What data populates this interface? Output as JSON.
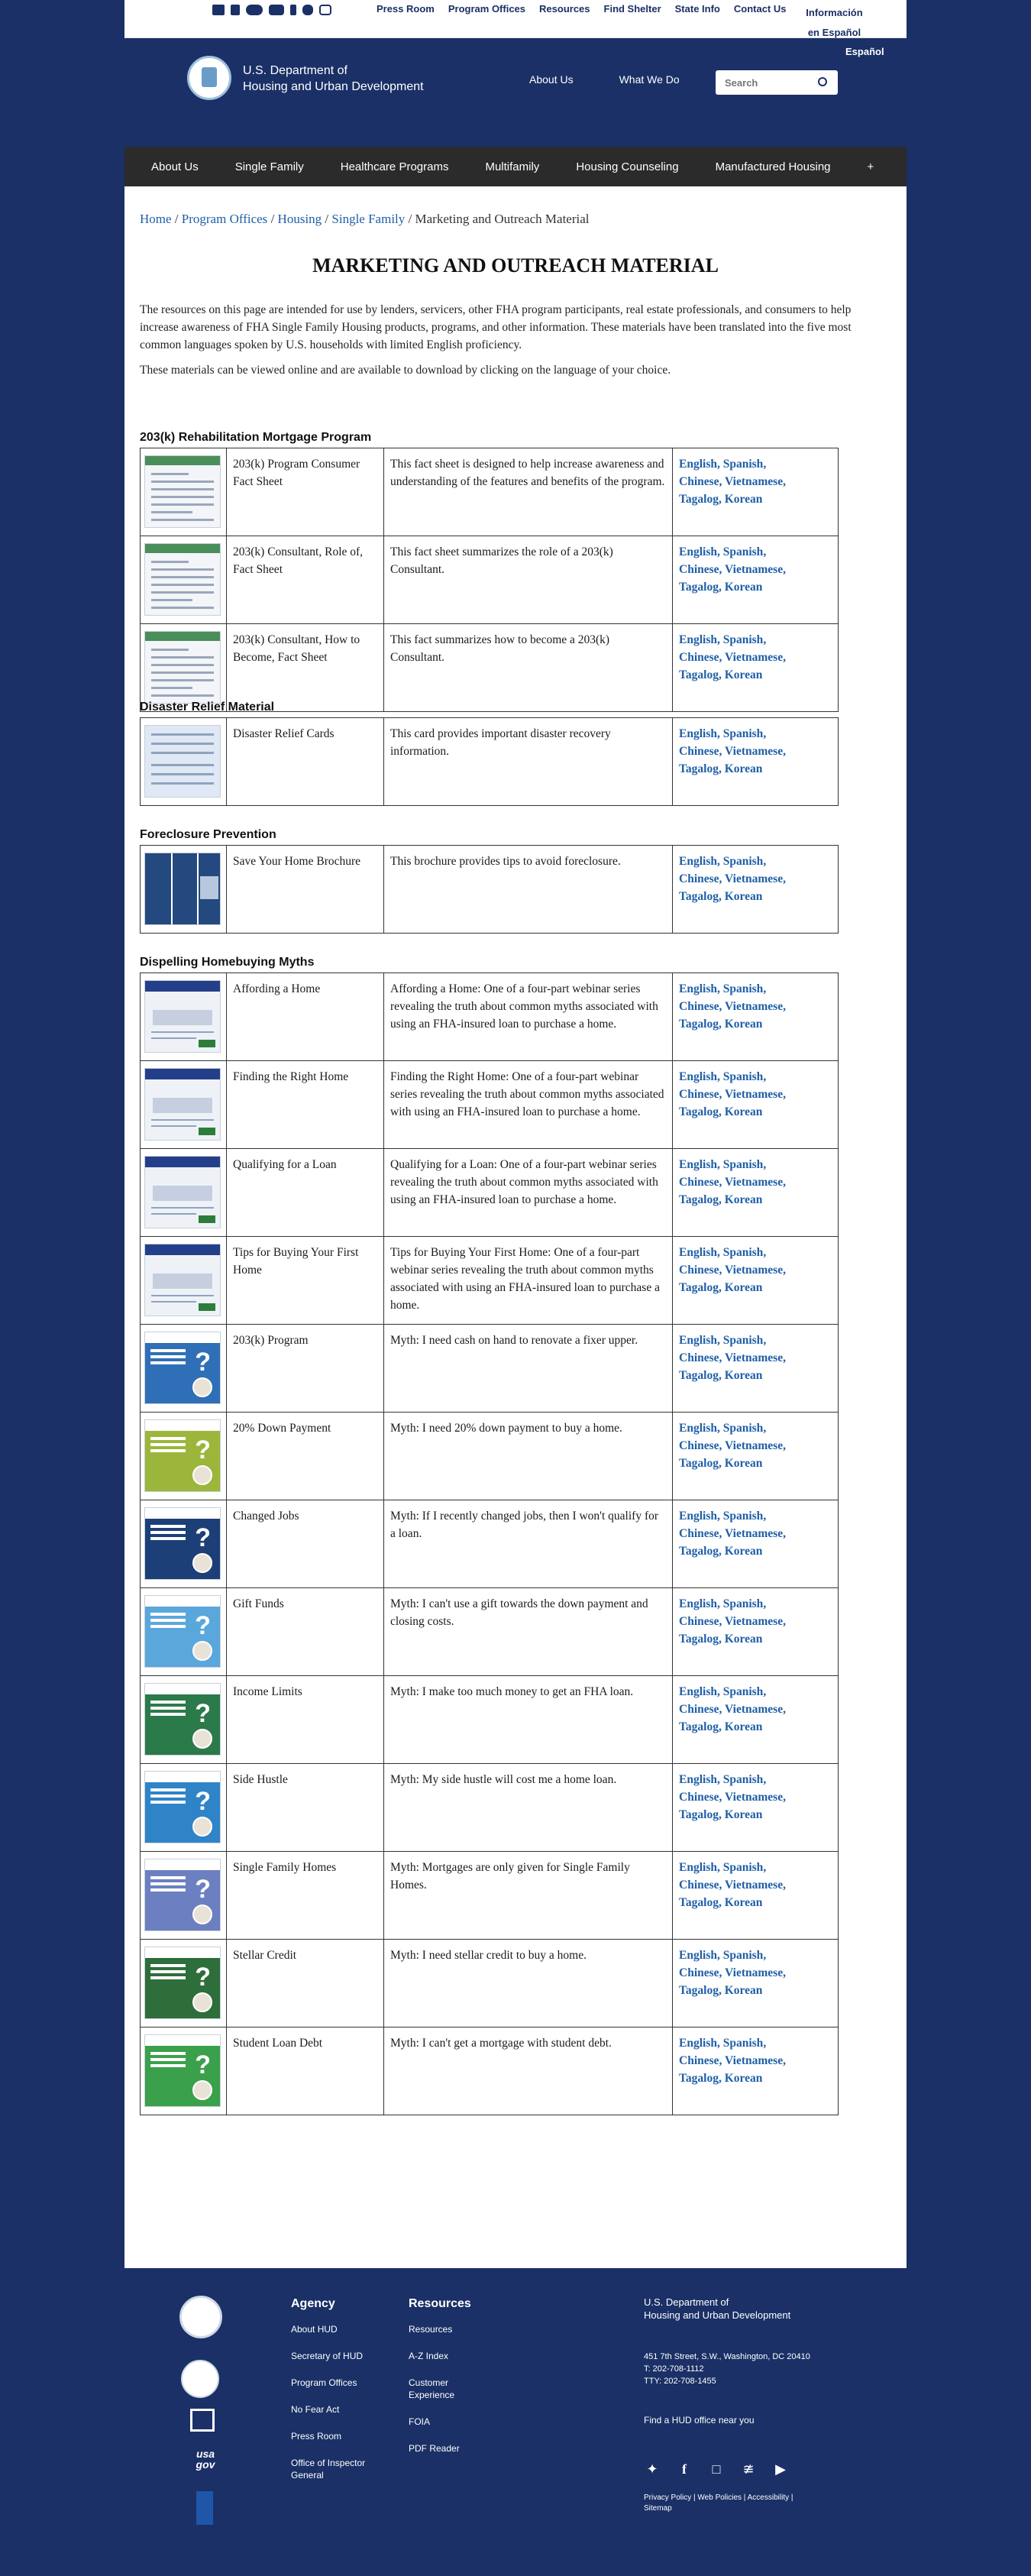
{
  "utility": {
    "links": [
      "Press Room",
      "Program Offices",
      "Resources",
      "Find Shelter",
      "State Info",
      "Contact Us",
      "Información en Español"
    ],
    "social_icons": [
      "mail-icon",
      "rss-icon",
      "flickr-icon",
      "youtube-icon",
      "facebook-icon",
      "twitter-icon",
      "instagram-icon"
    ]
  },
  "header": {
    "espanol": "Español",
    "agency_line1": "U.S. Department of",
    "agency_line2": "Housing and Urban Development",
    "nav": [
      "About Us",
      "What We Do"
    ],
    "search_placeholder": "Search"
  },
  "main_nav": [
    "About Us",
    "Single Family",
    "Healthcare Programs",
    "Multifamily",
    "Housing Counseling",
    "Manufactured Housing",
    "+"
  ],
  "breadcrumb": {
    "links": [
      "Home",
      "Program Offices",
      "Housing",
      "Single Family"
    ],
    "separator": " / ",
    "current": "Marketing and Outreach Material"
  },
  "page_title": "MARKETING AND OUTREACH MATERIAL",
  "intro": [
    "The resources on this page are intended for use by lenders, servicers, other FHA program participants, real estate professionals, and consumers to help increase awareness of FHA Single Family Housing products, programs, and other information. These materials have been translated into the five most common languages spoken by U.S. households with limited English proficiency.",
    "These materials can be viewed online and are available to download by clicking on the language of your choice."
  ],
  "languages": [
    "English",
    "Spanish",
    "Chinese",
    "Vietnamese",
    "Tagalog",
    "Korean"
  ],
  "sections": [
    {
      "heading": "203(k) Rehabilitation Mortgage Program",
      "rows": [
        {
          "name": "203(k) Program Consumer Fact Sheet",
          "desc": "This fact sheet is designed to help increase awareness and understanding of the features and benefits of the program."
        },
        {
          "name": "203(k) Consultant, Role of, Fact Sheet",
          "desc": "This fact sheet summarizes the role of a 203(k) Consultant."
        },
        {
          "name": "203(k) Consultant, How to Become, Fact Sheet",
          "desc": "This fact summarizes how to become a 203(k) Consultant."
        }
      ]
    },
    {
      "heading": "Disaster Relief Material",
      "rows": [
        {
          "name": "Disaster Relief Cards",
          "desc": "This card provides important disaster recovery information."
        }
      ]
    },
    {
      "heading": "Foreclosure Prevention",
      "rows": [
        {
          "name": "Save Your Home Brochure",
          "desc": "This brochure provides tips to avoid foreclosure."
        }
      ]
    },
    {
      "heading": "Dispelling Homebuying Myths",
      "rows": [
        {
          "name": "Affording a Home",
          "desc": "Affording a Home: One of a four-part webinar series revealing the truth about common myths associated with using an FHA-insured loan to purchase a home."
        },
        {
          "name": "Finding the Right Home",
          "desc": "Finding the Right Home: One of a four-part webinar series revealing the truth about common myths associated with using an FHA-insured loan to purchase a home."
        },
        {
          "name": "Qualifying for a Loan",
          "desc": "Qualifying for a Loan: One of a four-part webinar series revealing the truth about common myths associated with using an FHA-insured loan to purchase a home."
        },
        {
          "name": "Tips for Buying Your First Home",
          "desc": "Tips for Buying Your First Home: One of a four-part webinar series revealing the truth about common myths associated with using an FHA-insured loan to purchase a home."
        },
        {
          "name": "203(k) Program",
          "desc": "Myth: I need cash on hand to renovate a fixer upper."
        },
        {
          "name": "20% Down Payment",
          "desc": "Myth: I need 20% down payment to buy a home."
        },
        {
          "name": "Changed Jobs",
          "desc": "Myth: If I recently changed jobs, then I won't qualify for a loan."
        },
        {
          "name": "Gift Funds",
          "desc": "Myth: I can't use a gift towards the down payment and closing costs."
        },
        {
          "name": "Income Limits",
          "desc": "Myth: I make too much money to get an FHA loan."
        },
        {
          "name": "Side Hustle",
          "desc": "Myth: My side hustle will cost me a home loan."
        },
        {
          "name": "Single Family Homes",
          "desc": "Myth: Mortgages are only given for Single Family Homes."
        },
        {
          "name": "Stellar Credit",
          "desc": "Myth: I need stellar credit to buy a home."
        },
        {
          "name": "Student Loan Debt",
          "desc": "Myth: I can't get a mortgage with student debt."
        }
      ]
    }
  ],
  "footer": {
    "agency_heading": "Agency",
    "agency_links": [
      "About HUD",
      "Secretary of HUD",
      "Program Offices",
      "No Fear Act",
      "Press Room",
      "Office of Inspector General"
    ],
    "resources_heading": "Resources",
    "resources_links": [
      "Resources",
      "A-Z Index",
      "Customer Experience",
      "FOIA",
      "PDF Reader"
    ],
    "agency_name_line1": "U.S. Department of",
    "agency_name_line2": "Housing and Urban Development",
    "address_line1": "451 7th Street, S.W., Washington, DC 20410",
    "address_line2": "T: 202-708-1112",
    "address_line3": "TTY: 202-708-1455",
    "find_office": "Find a HUD office near you",
    "legal_links": [
      "Privacy Policy",
      "Web Policies",
      "Accessibility",
      "Sitemap"
    ],
    "usagov": "usa gov",
    "social_icons": [
      "twitter-icon",
      "facebook-icon",
      "instagram-icon",
      "rss-icon",
      "youtube-icon"
    ]
  }
}
